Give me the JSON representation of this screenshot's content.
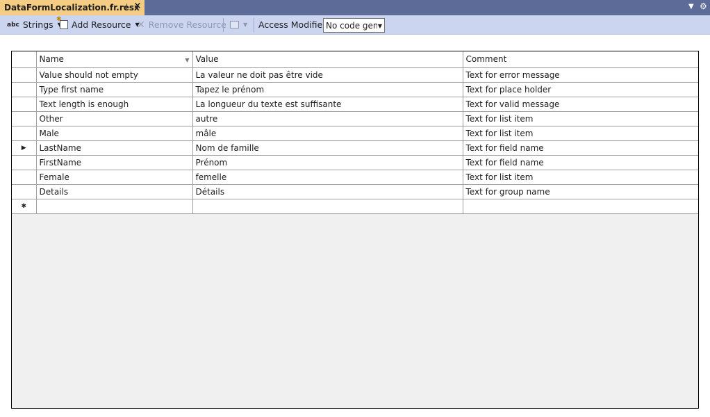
{
  "tab": {
    "title": "DataFormLocalization.fr.resx",
    "pin_glyph": "⊣",
    "close_glyph": "✕"
  },
  "toolbar": {
    "strings_label": "Strings",
    "add_resource_label": "Add Resource",
    "remove_resource_label": "Remove Resource",
    "access_modifier_label": "Access Modifier:",
    "access_modifier_value": "No code generation"
  },
  "icons": {
    "abc": "abc",
    "remove": "✕",
    "caret": "▼",
    "sort": "▼",
    "current_row": "▶",
    "new_row": "✱",
    "overflow": "▼",
    "settings": "⚙"
  },
  "grid": {
    "columns": [
      "Name",
      "Value",
      "Comment"
    ],
    "rows": [
      {
        "name": "Value should not empty",
        "value": "La valeur ne doit pas être vide",
        "comment": "Text for error message"
      },
      {
        "name": "Type first name",
        "value": "Tapez le prénom",
        "comment": "Text for place holder"
      },
      {
        "name": "Text length is enough",
        "value": "La longueur du texte est suffisante",
        "comment": "Text for valid message"
      },
      {
        "name": "Other",
        "value": "autre",
        "comment": "Text for list item"
      },
      {
        "name": "Male",
        "value": "mâle",
        "comment": "Text for list item"
      },
      {
        "name": "LastName",
        "value": "Nom de famille",
        "comment": "Text for field name"
      },
      {
        "name": "FirstName",
        "value": "Prénom",
        "comment": "Text for field name"
      },
      {
        "name": "Female",
        "value": "femelle",
        "comment": "Text for list item"
      },
      {
        "name": "Details",
        "value": "Détails",
        "comment": "Text for group name"
      }
    ],
    "current_row_index": 5
  },
  "colors": {
    "tab_active": "#f5cc84",
    "tabstrip": "#5d6b99",
    "toolbar": "#ccd5f0",
    "grid_background": "#f0f0f0"
  }
}
